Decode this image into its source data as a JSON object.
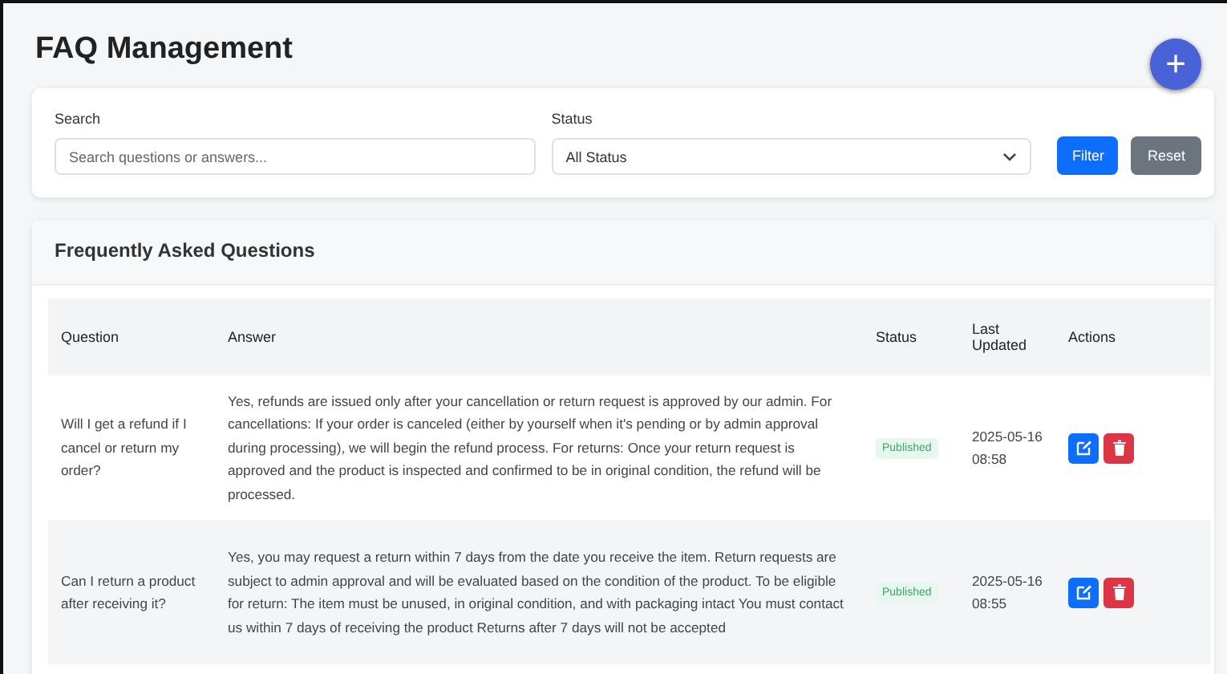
{
  "title": "FAQ Management",
  "add_button": {
    "label": "+"
  },
  "filters": {
    "search": {
      "label": "Search",
      "placeholder": "Search questions or answers..."
    },
    "status": {
      "label": "Status",
      "value": "All Status"
    },
    "buttons": [
      {
        "label": "Filter",
        "kind": "primary"
      },
      {
        "label": "Reset",
        "kind": "secondary"
      }
    ]
  },
  "table": {
    "title": "Frequently Asked Questions",
    "columns": [
      "Question",
      "Answer",
      "Status",
      "Last Updated",
      "Actions"
    ],
    "rows": [
      {
        "question": "Will I get a refund if I cancel or return my order?",
        "answer": "Yes, refunds are issued only after your cancellation or return request is approved by our admin. For cancellations: If your order is canceled (either by yourself when it's pending or by admin approval during processing), we will begin the refund process. For returns: Once your return request is approved and the product is inspected and confirmed to be in original condition, the refund will be processed.",
        "status": "Published",
        "updated": "2025-05-16 08:58"
      },
      {
        "question": "Can I return a product after receiving it?",
        "answer": "Yes, you may request a return within 7 days from the date you receive the item. Return requests are subject to admin approval and will be evaluated based on the condition of the product. To be eligible for return: The item must be unused, in original condition, and with packaging intact You must contact us within 7 days of receiving the product Returns after 7 days will not be accepted",
        "status": "Published",
        "updated": "2025-05-16 08:55"
      }
    ]
  }
}
